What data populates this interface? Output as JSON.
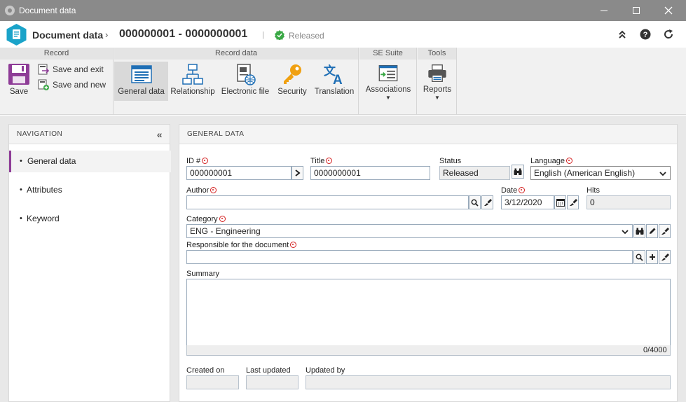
{
  "window": {
    "title": "Document data"
  },
  "header": {
    "module": "Document data",
    "record": "000000001 - 0000000001",
    "separator": "|",
    "status": "Released"
  },
  "ribbon": {
    "groups": {
      "record": "Record",
      "record_data": "Record data",
      "se_suite": "SE Suite",
      "tools": "Tools"
    },
    "save": "Save",
    "save_exit": "Save and exit",
    "save_new": "Save and new",
    "general_data": "General data",
    "relationship": "Relationship",
    "electronic_file": "Electronic file",
    "security": "Security",
    "translation": "Translation",
    "associations": "Associations",
    "reports": "Reports"
  },
  "nav": {
    "title": "NAVIGATION",
    "items": [
      {
        "label": "General data"
      },
      {
        "label": "Attributes"
      },
      {
        "label": "Keyword"
      }
    ]
  },
  "form": {
    "title": "GENERAL DATA",
    "id_label": "ID #",
    "id_value": "000000001",
    "title_label": "Title",
    "title_value": "0000000001",
    "status_label": "Status",
    "status_value": "Released",
    "language_label": "Language",
    "language_value": "English (American English)",
    "author_label": "Author",
    "author_value": "",
    "date_label": "Date",
    "date_value": "3/12/2020",
    "hits_label": "Hits",
    "hits_value": "0",
    "category_label": "Category",
    "category_value": "ENG - Engineering",
    "responsible_label": "Responsible for the document",
    "responsible_value": "",
    "summary_label": "Summary",
    "summary_value": "",
    "summary_counter": "0/4000",
    "created_label": "Created on",
    "created_value": "",
    "updated_label": "Last updated",
    "updated_value": "",
    "updated_by_label": "Updated by",
    "updated_by_value": ""
  },
  "colors": {
    "accent": "#8e3c97",
    "brand": "#1aa3c9",
    "status_green": "#3aa845",
    "required": "#d42020"
  }
}
